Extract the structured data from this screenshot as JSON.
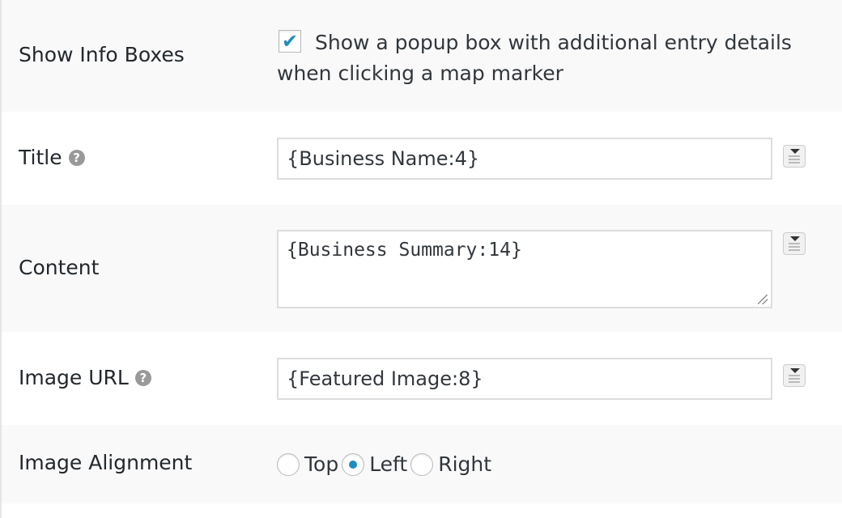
{
  "show_info_boxes": {
    "label": "Show Info Boxes",
    "checked": true,
    "checkbox_mark": "✔",
    "description": "Show a popup box with additional entry details when clicking a map marker"
  },
  "title": {
    "label": "Title",
    "help_icon": "?",
    "value": "{Business Name:4}"
  },
  "content": {
    "label": "Content",
    "value": "{Business Summary:14}"
  },
  "image_url": {
    "label": "Image URL",
    "help_icon": "?",
    "value": "{Featured Image:8}"
  },
  "image_alignment": {
    "label": "Image Alignment",
    "options": [
      "Top",
      "Left",
      "Right"
    ],
    "selected": "Left"
  },
  "colors": {
    "accent": "#1e8cbe",
    "row_alt": "#f9f9f9",
    "border": "#dddddd"
  }
}
